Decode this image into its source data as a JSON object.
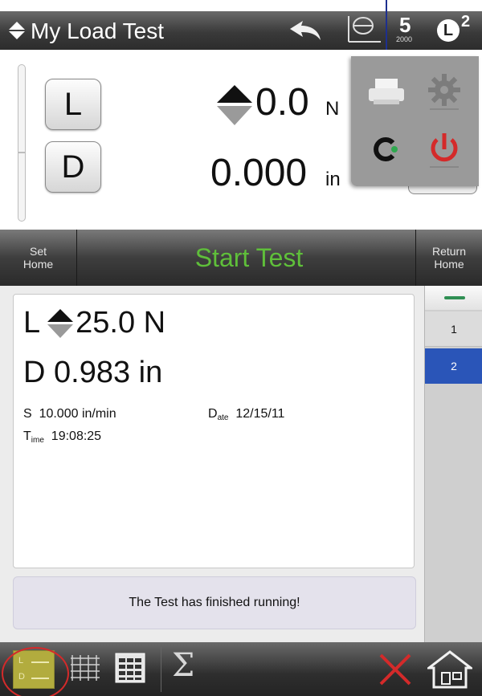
{
  "title_bar": {
    "title": "My Load Test",
    "speed_digit": "5",
    "speed_value": "2000",
    "user_letter": "L",
    "user_count": "2"
  },
  "readout": {
    "load_channel": "L",
    "load_value": "0.0",
    "load_unit": "N",
    "disp_channel": "D",
    "disp_value": "0.000",
    "disp_unit": "in"
  },
  "popup_menu": {
    "icons": [
      "printer-icon",
      "gear-icon",
      "refresh-icon",
      "power-icon"
    ]
  },
  "action_bar": {
    "set_home": "Set Home",
    "start_test": "Start Test",
    "return_home": "Return Home"
  },
  "results": {
    "load_label": "L",
    "load_value": "25.0 N",
    "disp_value": "D 0.983 in",
    "speed_label": "S",
    "speed_value": "10.000 in/min",
    "date_label_main": "D",
    "date_label_sub": "ate",
    "date_value": "12/15/11",
    "time_label_main": "T",
    "time_label_sub": "ime",
    "time_value": "19:08:25"
  },
  "message": "The Test has finished running!",
  "test_list": {
    "items": [
      "1",
      "2"
    ],
    "selected": "2"
  },
  "bottom_bar": {
    "ld_label_l": "L",
    "ld_label_d": "D"
  },
  "colors": {
    "start_text": "#5fbf3a",
    "selected_row": "#2a55b8",
    "power": "#d42a2a",
    "callout": "#1d2f8f"
  }
}
